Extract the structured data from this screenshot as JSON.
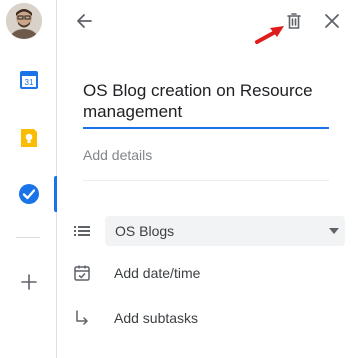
{
  "task": {
    "title": "OS Blog creation on Resource management",
    "details_placeholder": "Add details",
    "list_name": "OS Blogs",
    "add_datetime_label": "Add date/time",
    "add_subtasks_label": "Add subtasks"
  },
  "colors": {
    "accent": "#1a73e8",
    "calendar_blue": "#1a73e8",
    "keep_yellow": "#fbbc04",
    "annotation_red": "#e01b1b"
  },
  "icons": {
    "back": "arrow-left-icon",
    "delete": "trash-icon",
    "close": "close-icon",
    "list": "list-icon",
    "date": "calendar-check-icon",
    "subtasks": "subtask-arrow-icon",
    "dropdown": "caret-down-icon"
  }
}
